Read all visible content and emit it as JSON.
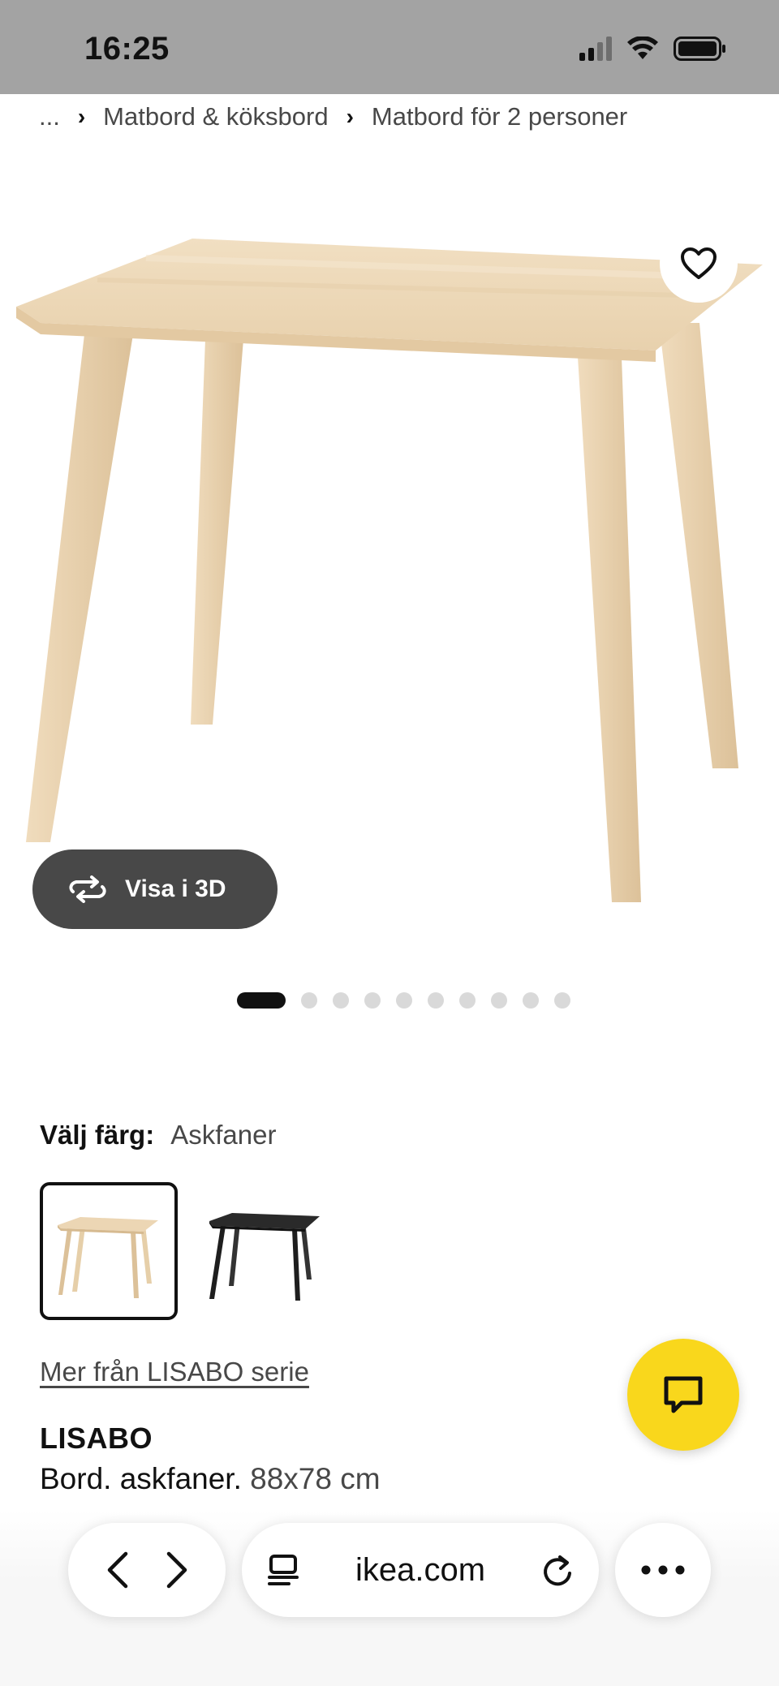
{
  "status_bar": {
    "time": "16:25"
  },
  "breadcrumb": {
    "ellipsis": "...",
    "items": [
      "Matbord & köksbord",
      "Matbord för 2 personer"
    ]
  },
  "gallery": {
    "view_3d_label": "Visa i 3D",
    "total_images": 10,
    "active_index": 0
  },
  "color_choice": {
    "label": "Välj färg:",
    "selected": "Askfaner",
    "options": [
      "Askfaner",
      "svart"
    ]
  },
  "series_link": "Mer från LISABO serie",
  "product": {
    "name": "LISABO",
    "description": "Bord. askfaner.",
    "dimensions": "88x78 cm"
  },
  "browser": {
    "url": "ikea.com"
  },
  "colors": {
    "status_bar_bg": "#a3a3a3",
    "chat_button": "#f9d71c",
    "view3d_button": "#484848",
    "wood": "#ecd6b4"
  }
}
